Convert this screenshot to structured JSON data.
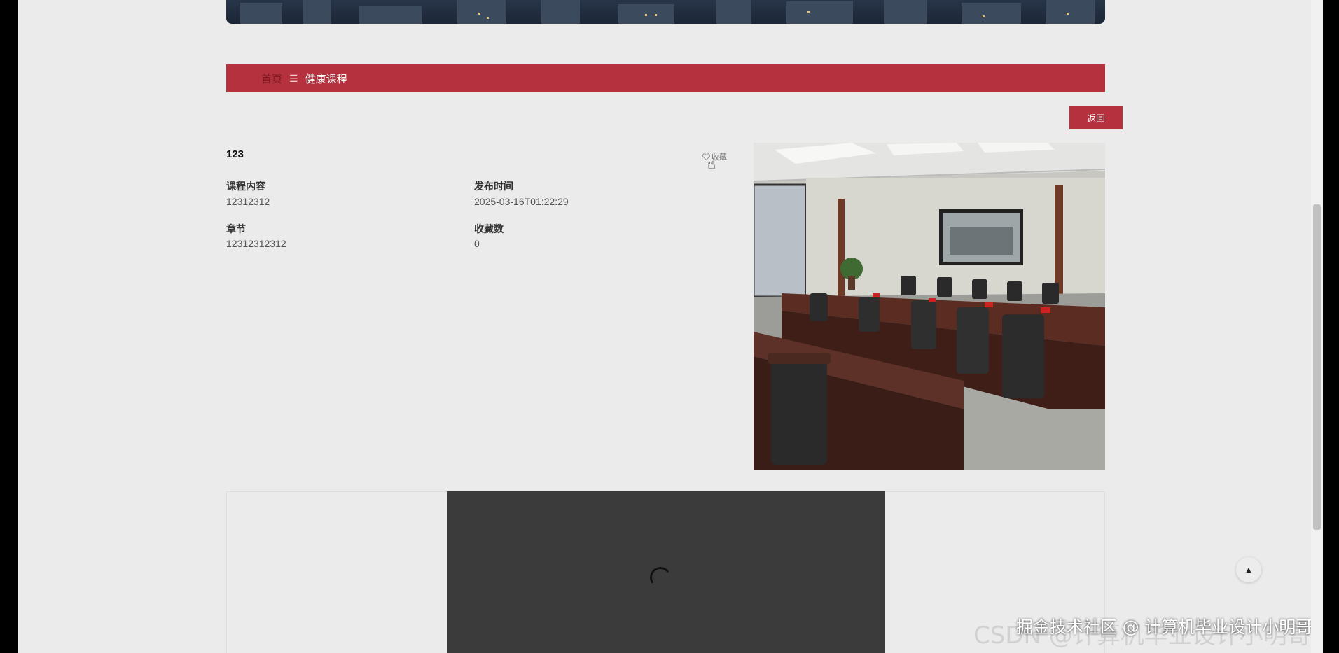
{
  "breadcrumb": {
    "home": "首页",
    "separator": "☰",
    "current": "健康课程"
  },
  "actions": {
    "back_label": "返回",
    "favorite_label": "收藏"
  },
  "course": {
    "title": "123",
    "fields": [
      {
        "label": "课程内容",
        "value": "12312312"
      },
      {
        "label": "发布时间",
        "value": "2025-03-16T01:22:29"
      },
      {
        "label": "章节",
        "value": "12312312312"
      },
      {
        "label": "收藏数",
        "value": "0"
      }
    ]
  },
  "watermark": {
    "text": "掘金技术社区 @ 计算机毕业设计小明哥",
    "faded": "CSDN @计算机毕业设计小明哥"
  },
  "colors": {
    "accent": "#b5313e",
    "page_bg": "#ebebeb"
  }
}
